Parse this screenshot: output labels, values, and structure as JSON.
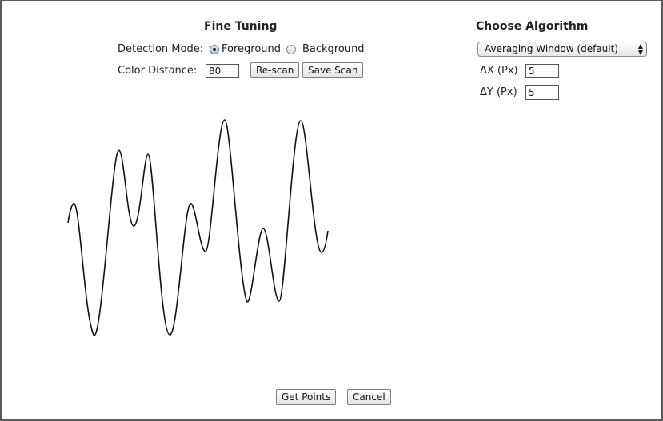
{
  "fine_tuning": {
    "title": "Fine Tuning",
    "detection_mode_label": "Detection Mode:",
    "foreground_label": "Foreground",
    "background_label": "Background",
    "selected_mode": "Foreground",
    "color_distance_label": "Color Distance:",
    "color_distance_value": "80",
    "rescan_label": "Re-scan",
    "save_scan_label": "Save Scan"
  },
  "algorithm": {
    "title": "Choose Algorithm",
    "selected": "Averaging Window (default)",
    "dx_label": "ΔX (Px)",
    "dx_value": "5",
    "dy_label": "ΔY (Px)",
    "dy_value": "5"
  },
  "footer": {
    "get_points_label": "Get Points",
    "cancel_label": "Cancel"
  },
  "colors": {
    "dialog_border": "#5b5b5b",
    "radio_selected": "#4a7fc4",
    "curve": "#111111"
  }
}
